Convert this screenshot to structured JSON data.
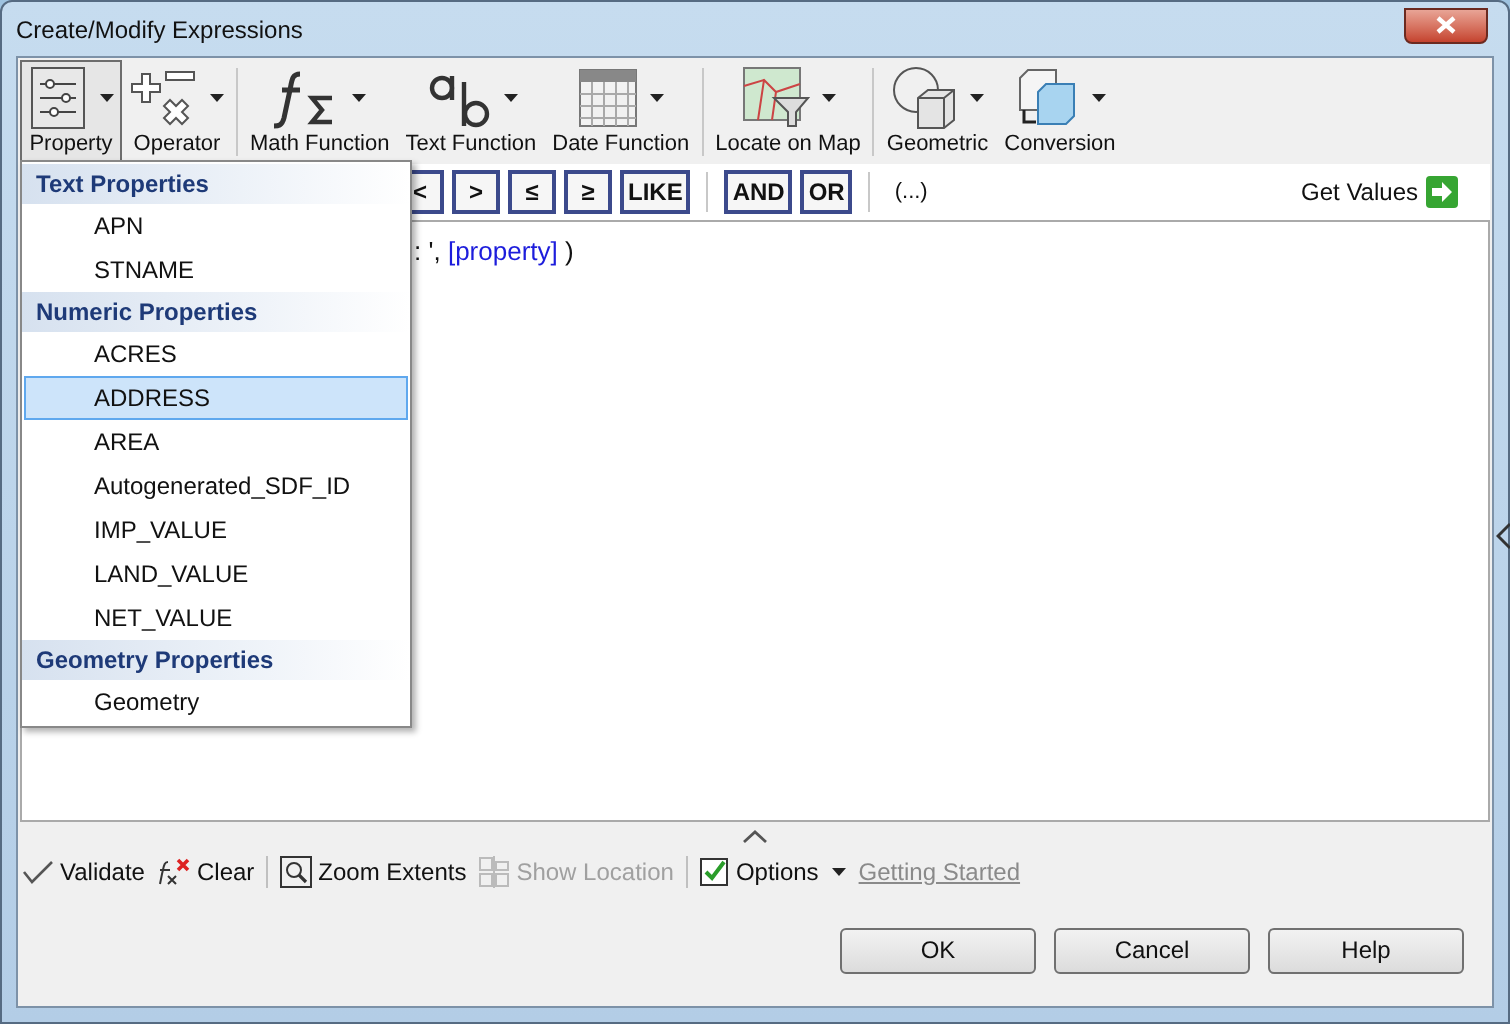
{
  "window": {
    "title": "Create/Modify Expressions"
  },
  "toolbar": [
    [
      {
        "label": "Property",
        "kind": "property",
        "selected": true
      },
      {
        "label": "Operator",
        "kind": "operator",
        "selected": false
      }
    ],
    [
      {
        "label": "Math Function",
        "kind": "math",
        "selected": false
      },
      {
        "label": "Text Function",
        "kind": "text",
        "selected": false
      },
      {
        "label": "Date Function",
        "kind": "date",
        "selected": false
      }
    ],
    [
      {
        "label": "Locate on Map",
        "kind": "map",
        "selected": false
      }
    ],
    [
      {
        "label": "Geometric",
        "kind": "geometric",
        "selected": false
      },
      {
        "label": "Conversion",
        "kind": "conversion",
        "selected": false
      }
    ]
  ],
  "operators": [
    [
      {
        "label": "<",
        "kind": "comparison"
      },
      {
        "label": ">",
        "kind": "comparison"
      },
      {
        "label": "≤",
        "kind": "comparison"
      },
      {
        "label": "≥",
        "kind": "comparison"
      },
      {
        "label": "LIKE",
        "kind": "comparison"
      }
    ],
    [
      {
        "label": "AND",
        "kind": "logic"
      },
      {
        "label": "OR",
        "kind": "logic"
      }
    ],
    [
      {
        "label": "(...)",
        "kind": "parentheses"
      }
    ]
  ],
  "get_values": "Get Values",
  "editor": {
    "text": ": ',",
    "token": "[property]",
    "tail": ")"
  },
  "property_menu": {
    "groups": [
      {
        "title": "Text Properties",
        "items": [
          {
            "label": "APN",
            "selected": false
          },
          {
            "label": "STNAME",
            "selected": false
          }
        ]
      },
      {
        "title": "Numeric Properties",
        "items": [
          {
            "label": "ACRES",
            "selected": false
          },
          {
            "label": "ADDRESS",
            "selected": true
          },
          {
            "label": "AREA",
            "selected": false
          },
          {
            "label": "Autogenerated_SDF_ID",
            "selected": false
          },
          {
            "label": "IMP_VALUE",
            "selected": false
          },
          {
            "label": "LAND_VALUE",
            "selected": false
          },
          {
            "label": "NET_VALUE",
            "selected": false
          }
        ]
      },
      {
        "title": "Geometry Properties",
        "items": [
          {
            "label": "Geometry",
            "selected": false
          }
        ]
      }
    ]
  },
  "bottom_toolbar": [
    [
      {
        "label": "Validate",
        "kind": "validate",
        "disabled": false
      },
      {
        "label": "Clear",
        "kind": "clear",
        "disabled": false
      }
    ],
    [
      {
        "label": "Zoom Extents",
        "kind": "zoom",
        "disabled": false
      },
      {
        "label": "Show Location",
        "kind": "location",
        "disabled": true
      }
    ],
    [
      {
        "label": "Options",
        "kind": "options",
        "disabled": false
      },
      {
        "label": "Getting Started",
        "kind": "link",
        "disabled": true
      }
    ]
  ],
  "buttons": [
    "OK",
    "Cancel",
    "Help"
  ]
}
